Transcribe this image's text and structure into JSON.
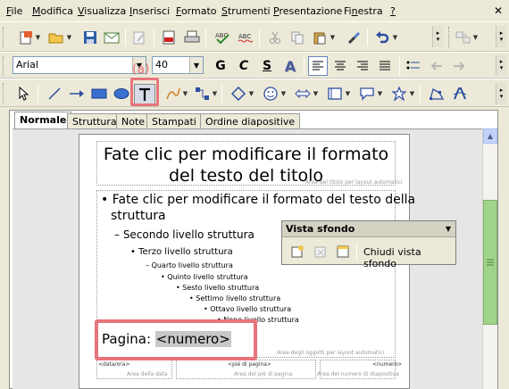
{
  "menu": {
    "items": [
      "File",
      "Modifica",
      "Visualizza",
      "Inserisci",
      "Formato",
      "Strumenti",
      "Presentazione",
      "Finestra",
      "?"
    ],
    "underline": [
      "F",
      "M",
      "V",
      "I",
      "F",
      "S",
      "P",
      "n",
      "?"
    ],
    "rest": [
      "ile",
      "odifica",
      "isualizza",
      "nserisci",
      "ormato",
      "trumenti",
      "resentazione",
      "",
      ""
    ],
    "close_glyph": "✕"
  },
  "finestra_parts": {
    "a": "Fi",
    "u": "n",
    "b": "estra"
  },
  "format_toolbar": {
    "font_name": "Arial",
    "font_size": "40",
    "bold": "G",
    "italic": "C",
    "underline": "S",
    "shadow": "A"
  },
  "annotation": {
    "label": "(a)"
  },
  "tabs": [
    "Normale",
    "Struttura",
    "Note",
    "Stampati",
    "Ordine diapositive"
  ],
  "slide": {
    "title": "Fate clic per modificare il formato del testo del titolo",
    "title_area_label": "Area del titolo per layout automatici",
    "outline": [
      "• Fate clic per modificare il formato del testo della",
      "struttura",
      "– Secondo livello struttura",
      "• Terzo livello struttura",
      "– Quarto livello struttura",
      "• Quinto livello struttura",
      "• Sesto livello struttura",
      "• Settimo livello struttura",
      "• Ottavo livello struttura",
      "• Nono livello struttura"
    ],
    "objects_area_label": "Area degli oggetti per layout automatici",
    "page_prefix": "Pagina:",
    "page_field": "<numero>",
    "footer_fields": [
      "<data/ora>",
      "<piè di pagina>",
      "<numero>"
    ],
    "footer_labels": [
      "Area della data",
      "Area del piè di pagina",
      "Area del numero di diapositiva"
    ]
  },
  "floating_toolbar": {
    "title": "Vista sfondo",
    "close_button": "Chiudi vista sfondo"
  }
}
